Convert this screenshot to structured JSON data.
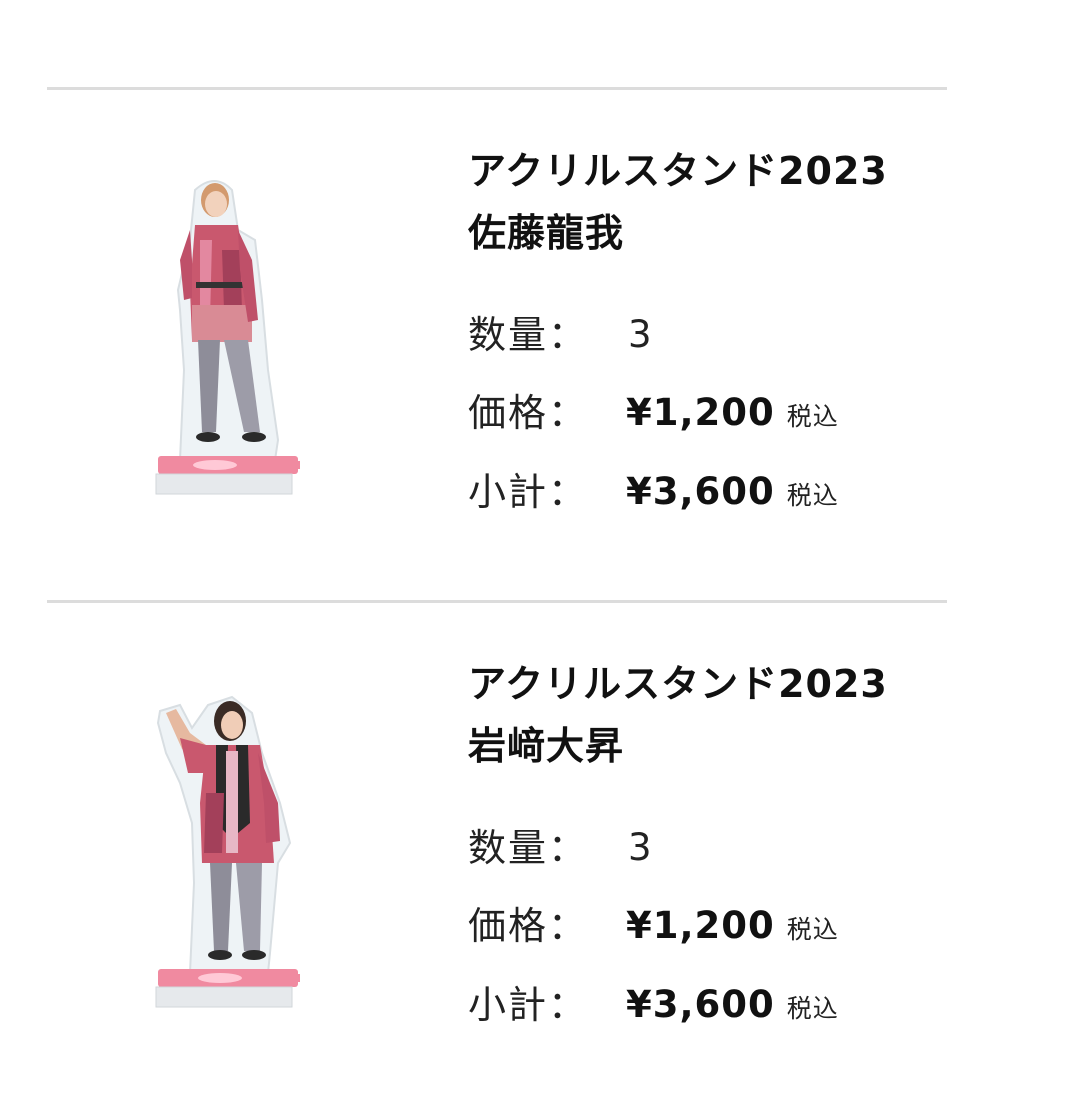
{
  "items": [
    {
      "title_line1": "アクリルスタンド2023",
      "title_line2": "佐藤龍我",
      "qty_label": "数量：",
      "qty_value": "3",
      "price_label": "価格：",
      "price_value": "¥1,200",
      "price_tax": "税込",
      "subtotal_label": "小計：",
      "subtotal_value": "¥3,600",
      "subtotal_tax": "税込"
    },
    {
      "title_line1": "アクリルスタンド2023",
      "title_line2": "岩﨑大昇",
      "qty_label": "数量：",
      "qty_value": "3",
      "price_label": "価格：",
      "price_value": "¥1,200",
      "price_tax": "税込",
      "subtotal_label": "小計：",
      "subtotal_value": "¥3,600",
      "subtotal_tax": "税込"
    }
  ],
  "colors": {
    "divider": "#dcdcdc",
    "jacket": "#c9586e",
    "pants": "#8e8d99",
    "base": "#f08aa0"
  }
}
